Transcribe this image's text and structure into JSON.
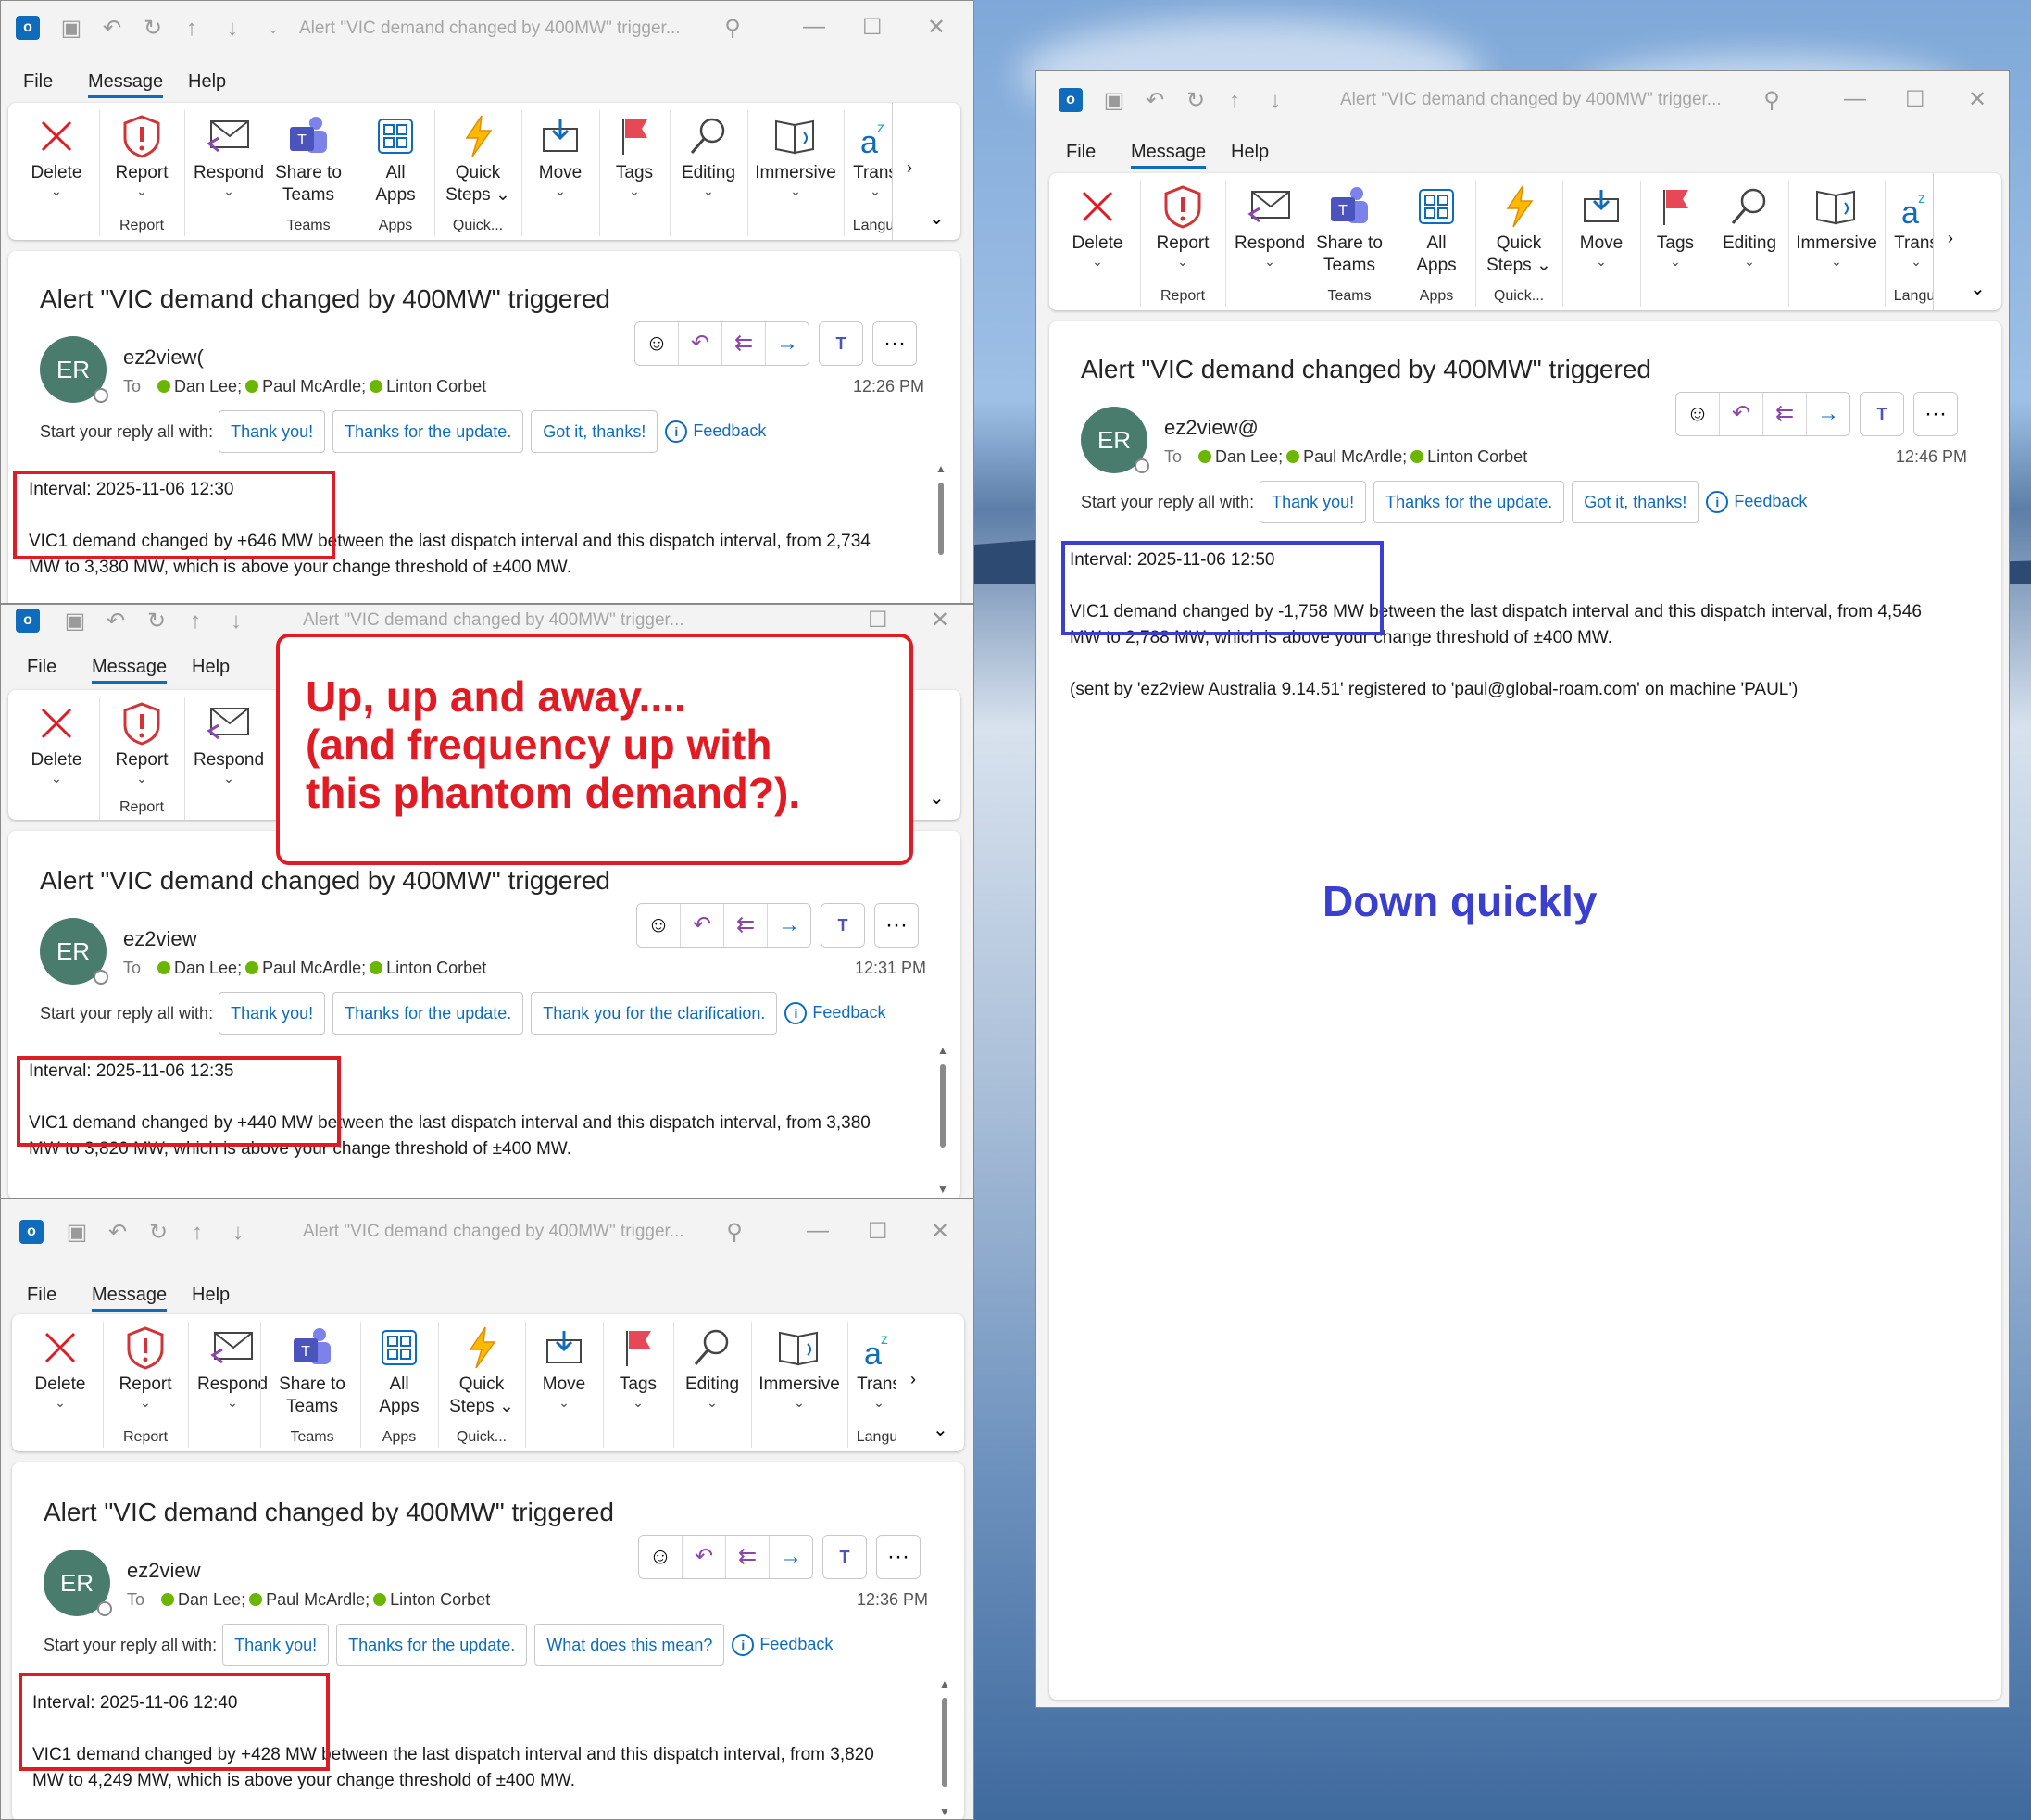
{
  "common": {
    "window_title": "Alert \"VIC demand changed by 400MW\" trigger...",
    "menu": {
      "file": "File",
      "message": "Message",
      "help": "Help"
    },
    "ribbon": {
      "delete": "Delete",
      "report": "Report",
      "respond": "Respond",
      "share_teams": "Share to\nTeams",
      "all_apps": "All\nApps",
      "quick_steps": "Quick\nSteps ⌄",
      "move": "Move",
      "tags": "Tags",
      "editing": "Editing",
      "immersive": "Immersive",
      "translate": "Trans",
      "group_report": "Report",
      "group_teams": "Teams",
      "group_apps": "Apps",
      "group_quick": "Quick...",
      "group_lang": "Langu"
    },
    "subject": "Alert \"VIC demand changed by 400MW\" triggered",
    "avatar_initials": "ER",
    "to_label": "To",
    "recipients": [
      "Dan Lee;",
      "Paul McArdle;",
      "Linton Corbet"
    ],
    "reply_lead": "Start your reply all with:",
    "feedback": "Feedback",
    "threshold_tail": "which is above your change threshold of ±400 MW."
  },
  "windows": [
    {
      "sender": "ez2view(",
      "time": "12:26 PM",
      "suggestions": [
        "Thank you!",
        "Thanks for the update.",
        "Got it, thanks!"
      ],
      "interval": "Interval: 2025-11-06 12:30",
      "line1": "VIC1 demand changed by +646 MW between the last dispatch interval and this dispatch interval, from 2,734",
      "line2": "MW to 3,380 MW, which is above your change threshold of ±400 MW."
    },
    {
      "sender": "ez2view",
      "time": "12:31 PM",
      "suggestions": [
        "Thank you!",
        "Thanks for the update.",
        "Thank you for the clarification."
      ],
      "interval": "Interval: 2025-11-06 12:35",
      "line1": "VIC1 demand changed by +440 MW between the last dispatch interval and this dispatch interval, from 3,380",
      "line2": "MW to 3,820 MW, which is above your change threshold of ±400 MW."
    },
    {
      "sender": "ez2view",
      "time": "12:36 PM",
      "suggestions": [
        "Thank you!",
        "Thanks for the update.",
        "What does this mean?"
      ],
      "interval": "Interval: 2025-11-06 12:40",
      "line1": "VIC1 demand changed by +428 MW between the last dispatch interval and this dispatch interval, from 3,820",
      "line2": "MW to 4,249 MW, which is above your change threshold of ±400 MW."
    },
    {
      "sender": "ez2view@",
      "time": "12:46 PM",
      "suggestions": [
        "Thank you!",
        "Thanks for the update.",
        "Got it, thanks!"
      ],
      "interval": "Interval: 2025-11-06 12:50",
      "line1": "VIC1 demand changed by -1,758 MW between the last dispatch interval and this dispatch interval, from 4,546",
      "line2": "MW to 2,788 MW, which is above your change threshold of ±400 MW.",
      "sent_by": "(sent by 'ez2view Australia 9.14.51' registered to 'paul@global-roam.com' on machine 'PAUL')"
    }
  ],
  "annotations": {
    "callout_lines": [
      "Up, up and away....",
      "(and frequency up with",
      "this phantom demand?)."
    ],
    "down_label": "Down quickly",
    "red_color": "#e01b24",
    "blue_color": "#3b3fd0"
  }
}
